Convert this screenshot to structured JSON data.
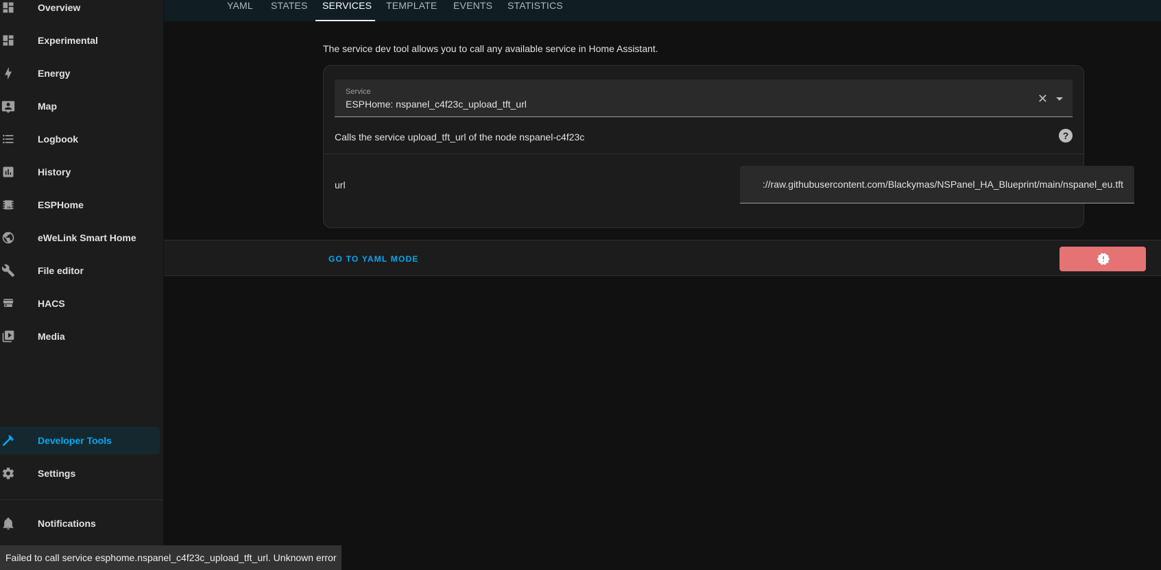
{
  "sidebar": {
    "items": [
      {
        "label": "Overview",
        "icon": "view-dashboard-icon"
      },
      {
        "label": "Experimental",
        "icon": "view-dashboard-icon"
      },
      {
        "label": "Energy",
        "icon": "lightning-bolt-icon"
      },
      {
        "label": "Map",
        "icon": "map-account-icon"
      },
      {
        "label": "Logbook",
        "icon": "format-list-bulleted-icon"
      },
      {
        "label": "History",
        "icon": "chart-box-icon"
      },
      {
        "label": "ESPHome",
        "icon": "chip-icon"
      },
      {
        "label": "eWeLink Smart Home",
        "icon": "earth-icon"
      },
      {
        "label": "File editor",
        "icon": "wrench-icon"
      },
      {
        "label": "HACS",
        "icon": "hacs-store-icon"
      },
      {
        "label": "Media",
        "icon": "play-box-multiple-icon"
      }
    ],
    "developer_tools": "Developer Tools",
    "settings": "Settings",
    "notifications": "Notifications"
  },
  "tabs": [
    "YAML",
    "STATES",
    "SERVICES",
    "TEMPLATE",
    "EVENTS",
    "STATISTICS"
  ],
  "active_tab": "SERVICES",
  "main": {
    "intro": "The service dev tool allows you to call any available service in Home Assistant.",
    "service_label": "Service",
    "service_value": "ESPHome: nspanel_c4f23c_upload_tft_url",
    "service_description": "Calls the service upload_tft_url of the node nspanel-c4f23c",
    "url_label": "url",
    "url_value": "://raw.githubusercontent.com/Blackymas/NSPanel_HA_Blueprint/main/nspanel_eu.tft"
  },
  "actions": {
    "yaml_mode": "GO TO YAML MODE",
    "call_button_color": "#e57373"
  },
  "toast": "Failed to call service esphome.nspanel_c4f23c_upload_tft_url. Unknown error",
  "colors": {
    "accent": "#03a9f4",
    "background": "#111111",
    "sidebar": "#1c1c1c",
    "tabbar": "#101e24"
  }
}
